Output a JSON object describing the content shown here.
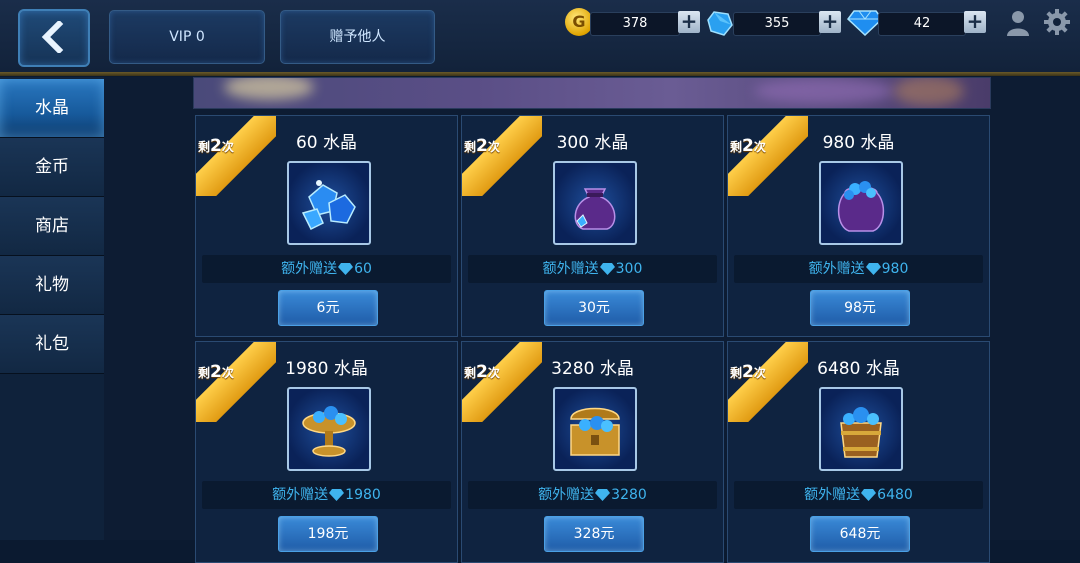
{
  "header": {
    "vip_label": "VIP 0",
    "gift_label": "赠予他人",
    "gold_value": "378",
    "gold_symbol": "G",
    "crystal_value": "355",
    "diamond_value": "42",
    "plus_label": "+"
  },
  "sidebar": {
    "items": [
      {
        "label": "水晶"
      },
      {
        "label": "金币"
      },
      {
        "label": "商店"
      },
      {
        "label": "礼物"
      },
      {
        "label": "礼包"
      }
    ],
    "active_index": 0
  },
  "shop": {
    "items": [
      {
        "remaining_prefix": "剩",
        "remaining_count": "2",
        "remaining_suffix": "次",
        "title": "60 水晶",
        "bonus_label": "额外赠送",
        "bonus_value": "60",
        "price": "6元",
        "icon": "crystal-cluster-icon"
      },
      {
        "remaining_prefix": "剩",
        "remaining_count": "2",
        "remaining_suffix": "次",
        "title": "300 水晶",
        "bonus_label": "额外赠送",
        "bonus_value": "300",
        "price": "30元",
        "icon": "purple-sack-icon"
      },
      {
        "remaining_prefix": "剩",
        "remaining_count": "2",
        "remaining_suffix": "次",
        "title": "980 水晶",
        "bonus_label": "额外赠送",
        "bonus_value": "980",
        "price": "98元",
        "icon": "full-sack-icon"
      },
      {
        "remaining_prefix": "剩",
        "remaining_count": "2",
        "remaining_suffix": "次",
        "title": "1980 水晶",
        "bonus_label": "额外赠送",
        "bonus_value": "1980",
        "price": "198元",
        "icon": "crystal-bowl-icon"
      },
      {
        "remaining_prefix": "剩",
        "remaining_count": "2",
        "remaining_suffix": "次",
        "title": "3280 水晶",
        "bonus_label": "额外赠送",
        "bonus_value": "3280",
        "price": "328元",
        "icon": "treasure-chest-icon"
      },
      {
        "remaining_prefix": "剩",
        "remaining_count": "2",
        "remaining_suffix": "次",
        "title": "6480 水晶",
        "bonus_label": "额外赠送",
        "bonus_value": "6480",
        "price": "648元",
        "icon": "crystal-barrel-icon"
      }
    ]
  },
  "colors": {
    "accent_blue": "#2a78c0",
    "bonus_text": "#3fb4ee",
    "ribbon_gold": "#f0b020",
    "background": "#0b1a30"
  }
}
